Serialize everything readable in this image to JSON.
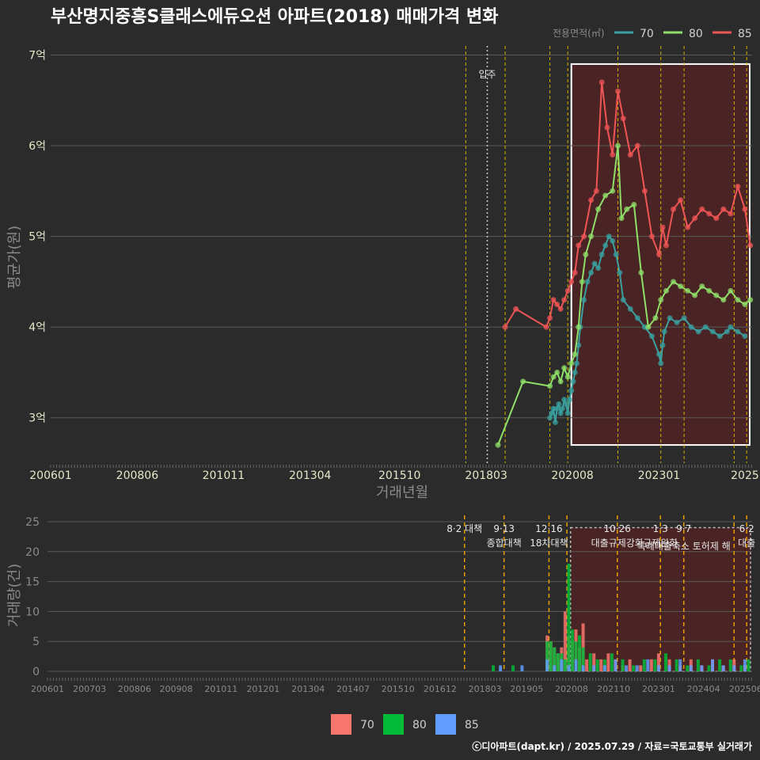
{
  "title": "부산명지중흥S클래스에듀오션 아파트(2018) 매매가격 변화",
  "footer": "ⓒ디아파트(dapt.kr) / 2025.07.29 / 자료=국토교통부 실거래가",
  "colors": {
    "70": "#3aa0a0",
    "80": "#8fe06a",
    "85": "#f05555",
    "bar70": "#f8766d",
    "bar80": "#00ba38",
    "bar85": "#619cff"
  },
  "chart_data": [
    {
      "type": "line",
      "xlabel": "거래년월",
      "ylabel": "평균가(원)",
      "x_tick_labels": [
        "200601",
        "200806",
        "201011",
        "201304",
        "201510",
        "201803",
        "202008",
        "202301",
        "2025"
      ],
      "y_tick_labels": [
        "3억",
        "4억",
        "5억",
        "6억",
        "7억"
      ],
      "y_ticks": [
        3,
        4,
        5,
        6,
        7
      ],
      "ylim": [
        2.5,
        7.1
      ],
      "xlim": [
        2006.0,
        2025.6
      ],
      "legend": {
        "title": "전용면적(㎡)",
        "entries": [
          "70",
          "80",
          "85"
        ],
        "placement": "top-right"
      },
      "move_in_label": "입주",
      "move_in_x": 2018.2,
      "policy_lines_x": [
        2017.6,
        2018.7,
        2019.95,
        2020.45,
        2021.85,
        2023.05,
        2023.7,
        2025.1,
        2025.45
      ],
      "highlight_range": [
        2020.55,
        2025.6
      ],
      "series": [
        {
          "name": "70",
          "x": [
            2019.95,
            2020.0,
            2020.05,
            2020.1,
            2020.15,
            2020.2,
            2020.25,
            2020.3,
            2020.35,
            2020.4,
            2020.45,
            2020.5,
            2020.55,
            2020.6,
            2020.65,
            2020.7,
            2020.75,
            2020.8,
            2020.9,
            2021.0,
            2021.1,
            2021.2,
            2021.3,
            2021.4,
            2021.5,
            2021.6,
            2021.7,
            2021.8,
            2021.9,
            2022.0,
            2022.2,
            2022.4,
            2022.6,
            2022.8,
            2023.0,
            2023.05,
            2023.1,
            2023.15,
            2023.3,
            2023.5,
            2023.7,
            2023.9,
            2024.1,
            2024.3,
            2024.5,
            2024.7,
            2024.9,
            2025.0,
            2025.2,
            2025.4
          ],
          "y": [
            3.0,
            3.05,
            3.1,
            2.95,
            3.1,
            3.15,
            3.05,
            3.1,
            3.2,
            3.15,
            3.05,
            3.2,
            3.3,
            3.4,
            3.5,
            3.6,
            3.8,
            4.0,
            4.3,
            4.5,
            4.6,
            4.7,
            4.65,
            4.8,
            4.9,
            5.0,
            4.95,
            4.8,
            4.6,
            4.3,
            4.2,
            4.1,
            4.0,
            3.9,
            3.7,
            3.6,
            3.8,
            3.95,
            4.1,
            4.05,
            4.1,
            4.0,
            3.95,
            4.0,
            3.95,
            3.9,
            3.95,
            4.0,
            3.95,
            3.9
          ]
        },
        {
          "name": "80",
          "x": [
            2018.5,
            2019.2,
            2019.95,
            2020.05,
            2020.15,
            2020.25,
            2020.35,
            2020.45,
            2020.55,
            2020.65,
            2020.75,
            2020.85,
            2020.95,
            2021.1,
            2021.3,
            2021.5,
            2021.7,
            2021.85,
            2021.95,
            2022.1,
            2022.3,
            2022.5,
            2022.7,
            2022.9,
            2023.05,
            2023.2,
            2023.4,
            2023.6,
            2023.8,
            2024.0,
            2024.2,
            2024.4,
            2024.6,
            2024.8,
            2025.0,
            2025.2,
            2025.4,
            2025.55
          ],
          "y": [
            2.7,
            3.4,
            3.35,
            3.45,
            3.5,
            3.4,
            3.55,
            3.45,
            3.6,
            3.7,
            4.0,
            4.5,
            4.8,
            5.0,
            5.3,
            5.45,
            5.5,
            6.0,
            5.2,
            5.3,
            5.35,
            4.6,
            4.0,
            4.1,
            4.3,
            4.4,
            4.5,
            4.45,
            4.4,
            4.35,
            4.45,
            4.4,
            4.35,
            4.3,
            4.4,
            4.3,
            4.25,
            4.3
          ]
        },
        {
          "name": "85",
          "x": [
            2018.7,
            2019.0,
            2019.85,
            2019.95,
            2020.05,
            2020.15,
            2020.25,
            2020.35,
            2020.45,
            2020.55,
            2020.65,
            2020.75,
            2020.9,
            2021.1,
            2021.25,
            2021.4,
            2021.55,
            2021.7,
            2021.85,
            2022.0,
            2022.2,
            2022.4,
            2022.6,
            2022.8,
            2023.0,
            2023.1,
            2023.2,
            2023.4,
            2023.6,
            2023.8,
            2024.0,
            2024.2,
            2024.4,
            2024.6,
            2024.8,
            2025.0,
            2025.2,
            2025.4,
            2025.55
          ],
          "y": [
            4.0,
            4.2,
            4.0,
            4.1,
            4.3,
            4.25,
            4.2,
            4.3,
            4.4,
            4.5,
            4.6,
            4.9,
            5.0,
            5.4,
            5.5,
            6.7,
            6.2,
            5.9,
            6.6,
            6.3,
            5.9,
            6.0,
            5.5,
            5.0,
            4.8,
            5.1,
            4.9,
            5.3,
            5.4,
            5.1,
            5.2,
            5.3,
            5.25,
            5.2,
            5.3,
            5.25,
            5.55,
            5.3,
            4.9
          ]
        }
      ]
    },
    {
      "type": "bar",
      "xlabel": "",
      "ylabel": "거래량(건)",
      "x_tick_labels": [
        "200601",
        "200703",
        "200806",
        "200908",
        "201011",
        "201201",
        "201304",
        "201407",
        "201510",
        "201612",
        "201803",
        "201905",
        "202008",
        "202110",
        "202301",
        "202404",
        "202506"
      ],
      "y_ticks": [
        0,
        5,
        10,
        15,
        20,
        25
      ],
      "ylim": [
        0,
        25
      ],
      "xlim": [
        2006.0,
        2025.6
      ],
      "legend": {
        "entries": [
          "70",
          "80",
          "85"
        ],
        "placement": "bottom"
      },
      "highlight_range": [
        2020.55,
        2025.6
      ],
      "policy_lines_x": [
        2017.6,
        2018.7,
        2019.95,
        2020.45,
        2021.85,
        2023.05,
        2023.7,
        2025.1,
        2025.45
      ],
      "policy_labels": [
        {
          "x": 2017.6,
          "line1": "8·2 대책",
          "line2": ""
        },
        {
          "x": 2018.7,
          "line1": "9·13",
          "line2": "종합대책"
        },
        {
          "x": 2019.95,
          "line1": "12·16",
          "line2": "18차대책"
        },
        {
          "x": 2021.85,
          "line1": "10·26",
          "line2": "대출규제강화"
        },
        {
          "x": 2023.05,
          "line1": "1·3",
          "line2": "규제완화"
        },
        {
          "x": 2023.7,
          "line1": "9·7",
          "line2": "특례대출축소 토허제 해"
        },
        {
          "x": 2025.45,
          "line1": "6·2",
          "line2": "대출"
        }
      ],
      "series": [
        {
          "name": "70",
          "x": [
            2019.9,
            2020.0,
            2020.1,
            2020.2,
            2020.3,
            2020.4,
            2020.5,
            2020.6,
            2020.7,
            2020.8,
            2020.9,
            2021.0,
            2021.2,
            2021.4,
            2021.6,
            2021.8,
            2022.0,
            2022.2,
            2022.5,
            2022.8,
            2023.0,
            2023.3,
            2023.6,
            2023.9,
            2024.2,
            2024.5,
            2024.8,
            2025.1,
            2025.4
          ],
          "values": [
            6,
            5,
            4,
            3,
            4,
            10,
            6,
            5,
            7,
            4,
            8,
            2,
            3,
            2,
            3,
            2,
            1,
            2,
            1,
            2,
            3,
            2,
            1,
            2,
            1,
            2,
            1,
            2,
            1
          ]
        },
        {
          "name": "80",
          "x": [
            2018.4,
            2018.95,
            2019.9,
            2020.0,
            2020.1,
            2020.2,
            2020.3,
            2020.4,
            2020.5,
            2020.6,
            2020.7,
            2020.8,
            2020.9,
            2021.1,
            2021.3,
            2021.5,
            2021.7,
            2022.0,
            2022.3,
            2022.6,
            2022.9,
            2023.2,
            2023.5,
            2023.8,
            2024.1,
            2024.4,
            2024.7,
            2025.0,
            2025.3,
            2025.5
          ],
          "values": [
            1,
            1,
            5,
            5,
            4,
            3,
            3,
            2,
            18,
            7,
            5,
            6,
            4,
            3,
            2,
            2,
            3,
            2,
            1,
            2,
            2,
            3,
            2,
            1,
            2,
            1,
            2,
            2,
            1,
            2
          ]
        },
        {
          "name": "85",
          "x": [
            2018.6,
            2019.2,
            2019.9,
            2020.1,
            2020.3,
            2020.5,
            2020.7,
            2020.9,
            2021.2,
            2021.5,
            2021.8,
            2022.1,
            2022.4,
            2022.7,
            2023.0,
            2023.3,
            2023.6,
            2023.9,
            2024.2,
            2024.5,
            2024.8,
            2025.1,
            2025.4
          ],
          "values": [
            1,
            1,
            2,
            1,
            2,
            1,
            2,
            1,
            1,
            1,
            2,
            1,
            1,
            2,
            1,
            1,
            2,
            1,
            1,
            2,
            1,
            1,
            2
          ]
        }
      ]
    }
  ]
}
